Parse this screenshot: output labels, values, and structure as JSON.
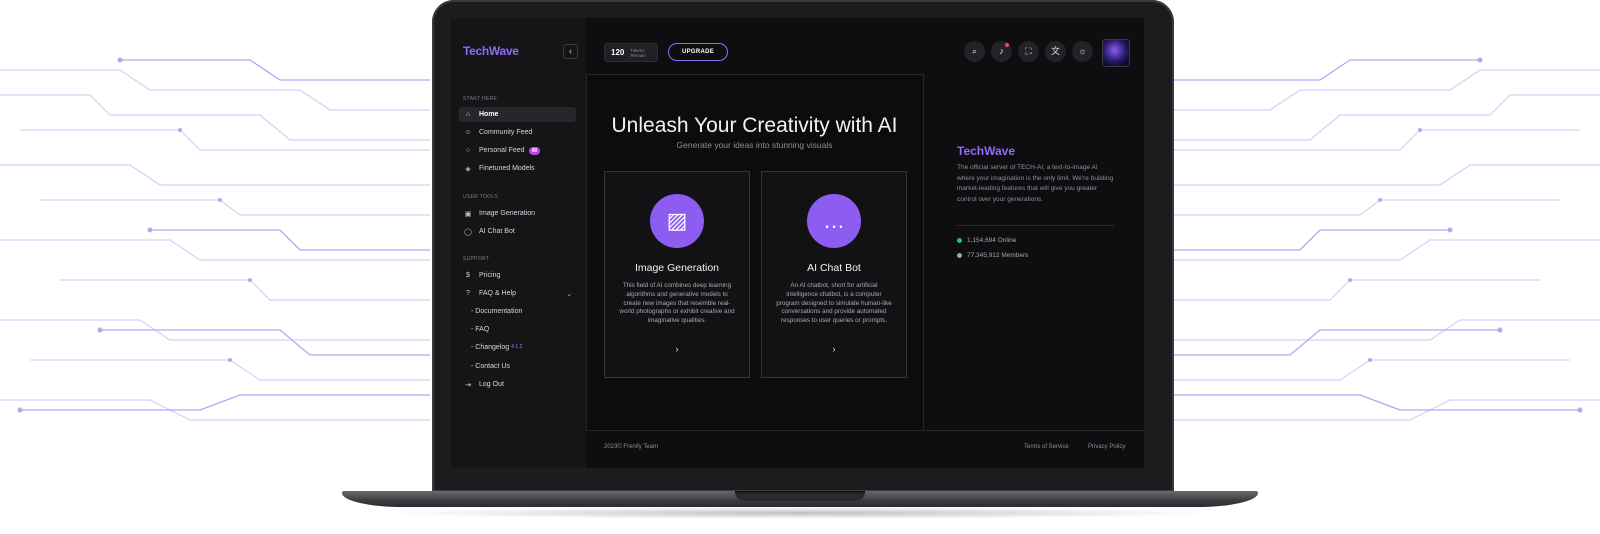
{
  "app": {
    "logo": "TechWave"
  },
  "sidebar": {
    "section_start": "START HERE",
    "section_tools": "USER TOOLS",
    "section_support": "SUPPORT",
    "items": [
      {
        "label": "Home",
        "icon": "home-icon"
      },
      {
        "label": "Community Feed",
        "icon": "users-icon"
      },
      {
        "label": "Personal Feed",
        "icon": "user-icon",
        "badge": "48"
      },
      {
        "label": "Finetuned Models",
        "icon": "cube-icon"
      },
      {
        "label": "Image Generation",
        "icon": "image-icon"
      },
      {
        "label": "AI Chat Bot",
        "icon": "chat-icon"
      },
      {
        "label": "Pricing",
        "icon": "dollar-icon"
      },
      {
        "label": "FAQ & Help",
        "icon": "help-icon"
      },
      {
        "label": "Log Out",
        "icon": "logout-icon"
      }
    ],
    "sub_items": [
      {
        "label": "Documentation"
      },
      {
        "label": "FAQ"
      },
      {
        "label": "Changelog",
        "version": "4.1.2"
      },
      {
        "label": "Contact Us"
      }
    ]
  },
  "topbar": {
    "tokens_value": "120",
    "tokens_label_1": "Tokens",
    "tokens_label_2": "Remain",
    "upgrade_label": "UPGRADE"
  },
  "main": {
    "title": "Unleash Your Creativity with AI",
    "subtitle": "Generate your ideas into stunning visuals",
    "cards": [
      {
        "title": "Image Generation",
        "description": "This field of AI combines deep learning algorithms and generative models to create new images that resemble real-world photographs or exhibit creative and imaginative qualities.",
        "icon": "image-icon"
      },
      {
        "title": "AI Chat Bot",
        "description": "An AI chatbot, short for artificial intelligence chatbot, is a computer program designed to simulate human-like conversations and provide automated responses to user queries or prompts.",
        "icon": "chat-bubble-icon"
      }
    ]
  },
  "panel": {
    "logo": "TechWave",
    "description": "The official server of TECH-AI, a text-to-image AI where your imagination is the only limit. We're building market-leading features that will give you greater control over your generations.",
    "online": "1,154,694 Online",
    "members": "77,345,912 Members"
  },
  "footer": {
    "copyright": "2023© Frenify Team",
    "terms": "Terms of Service",
    "privacy": "Privacy Policy"
  },
  "colors": {
    "accent": "#8d5cf0",
    "online": "#22c55e",
    "members": "#9ca3af",
    "badge": "#c03fe6"
  }
}
